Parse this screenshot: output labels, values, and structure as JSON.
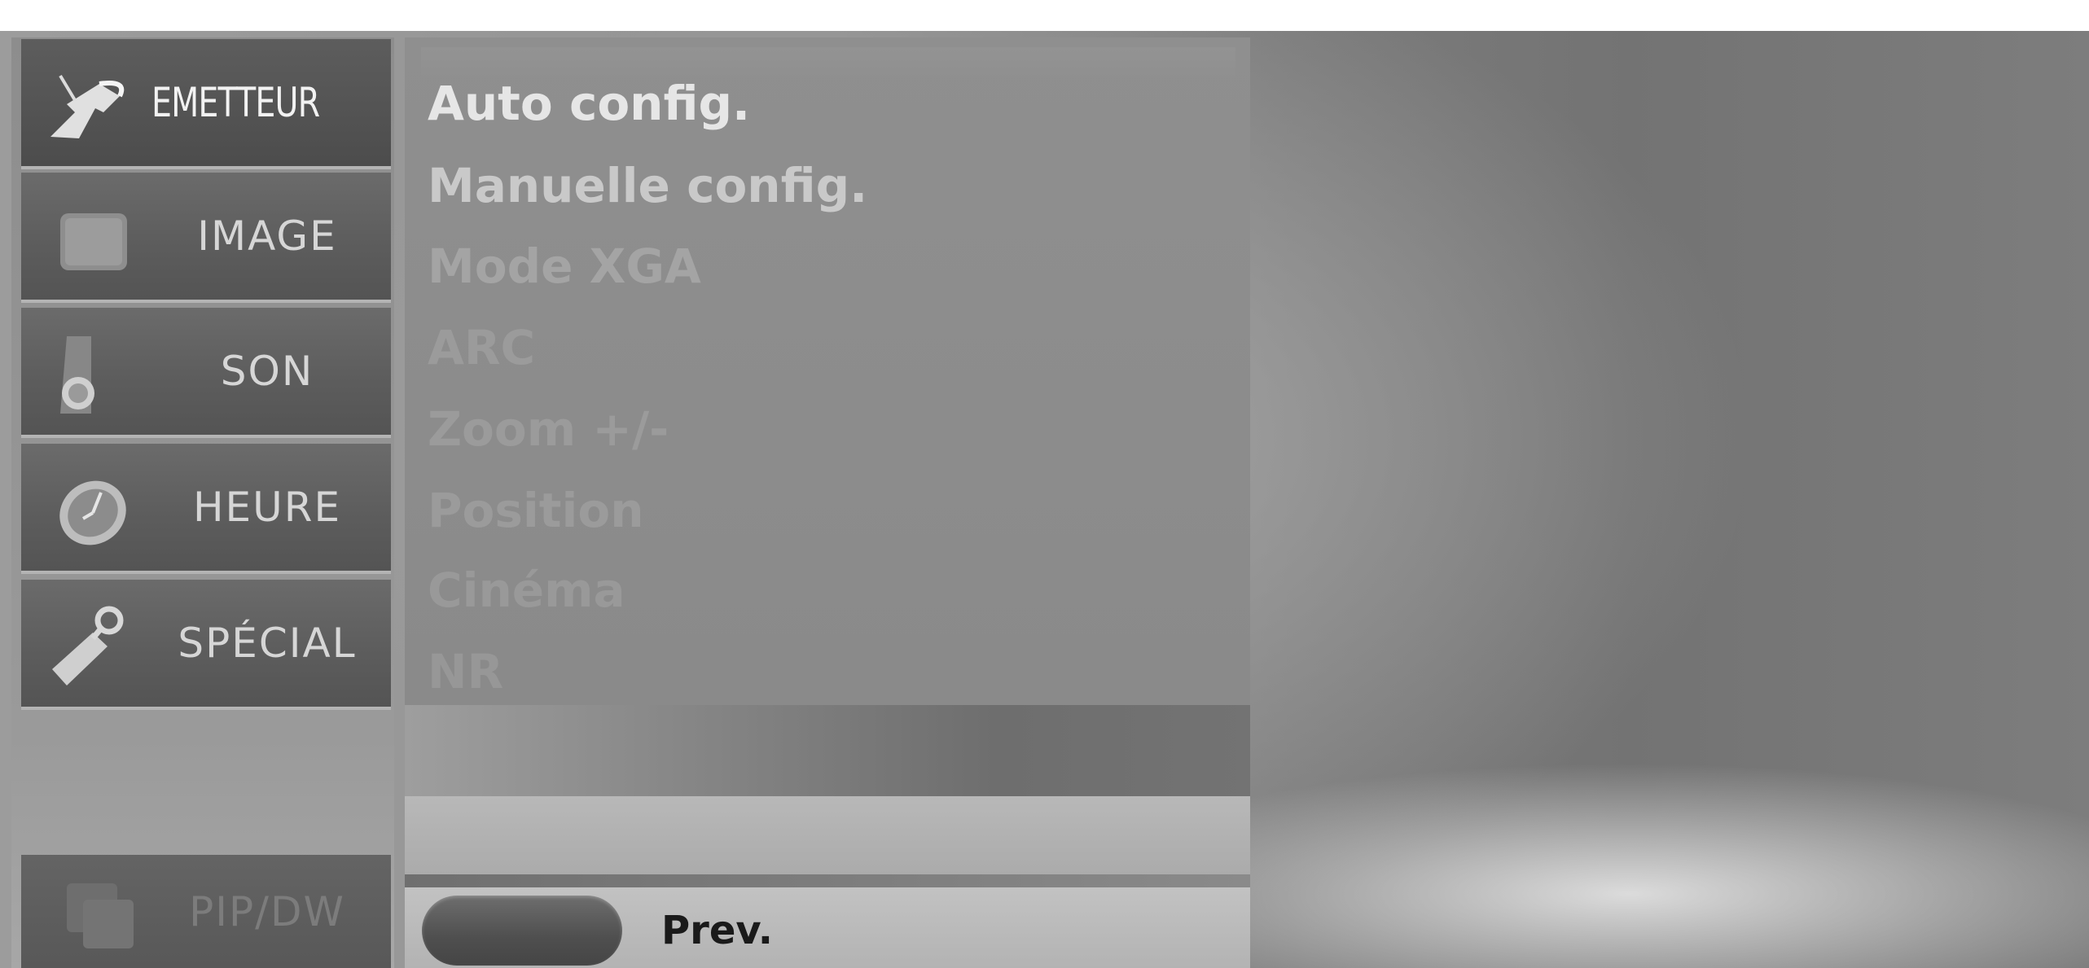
{
  "sidebar": {
    "items": [
      {
        "label": "EMETTEUR",
        "icon": "satellite-dish-icon",
        "active": true
      },
      {
        "label": "IMAGE",
        "icon": "picture-icon"
      },
      {
        "label": "SON",
        "icon": "speaker-icon"
      },
      {
        "label": "HEURE",
        "icon": "clock-icon"
      },
      {
        "label": "SPÉCIAL",
        "icon": "tag-icon"
      }
    ],
    "pip": {
      "label": "PIP/DW",
      "icon": "pip-window-icon"
    }
  },
  "menu": {
    "items": [
      {
        "label": "Auto config.",
        "color": "#e6e6e6"
      },
      {
        "label": "Manuelle config.",
        "color": "#c9c9c9"
      },
      {
        "label": "Mode XGA",
        "color": "#a4a4a4"
      },
      {
        "label": "ARC",
        "color": "#9b9b9b"
      },
      {
        "label": "Zoom +/-",
        "color": "#9b9b9b"
      },
      {
        "label": "Position",
        "color": "#9b9b9b"
      },
      {
        "label": "Cinéma",
        "color": "#999999"
      },
      {
        "label": "NR",
        "color": "#979797"
      }
    ]
  },
  "footer": {
    "prev_label": "Prev."
  }
}
